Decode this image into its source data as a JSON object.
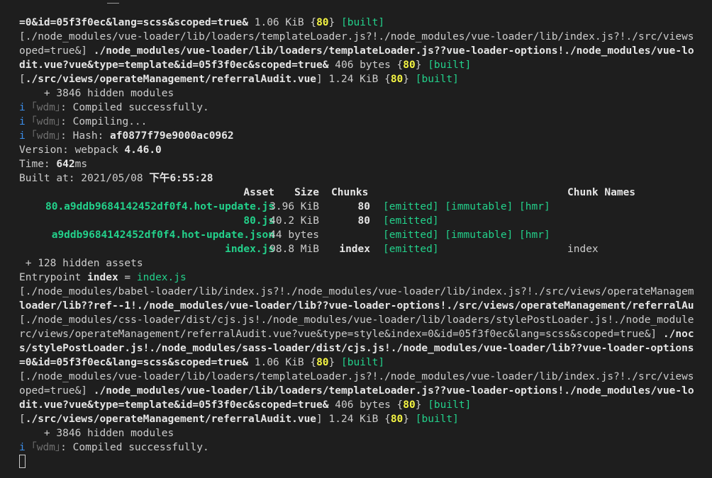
{
  "terminal": {
    "l1": {
      "p": "=0&id=05f3f0ec&lang=scss&scoped=true&",
      "size": " 1.06 KiB ",
      "chunk": "80",
      "status": "[built]"
    },
    "l2": "[./node_modules/vue-loader/lib/loaders/templateLoader.js?!./node_modules/vue-loader/lib/index.js?!./src/views",
    "l3": {
      "p1": "oped=true&] ",
      "p2": "./node_modules/vue-loader/lib/loaders/templateLoader.js??vue-loader-options!./node_modules/vue-lo"
    },
    "l4": {
      "p": "dit.vue?vue&type=template&id=05f3f0ec&scoped=true&",
      "size": " 406 bytes ",
      "chunk": "80",
      "status": "[built]"
    },
    "l5": {
      "p1": "[",
      "p2": "./src/views/operateManagement/referralAudit.vue",
      "p3": "] 1.24 KiB ",
      "chunk": "80",
      "status": "[built]"
    },
    "l6": "    + 3846 hidden modules",
    "l7": {
      "icon": "i",
      "wdm": "｢wdm｣",
      "text": ": Compiled successfully."
    },
    "l8": {
      "icon": "i",
      "wdm": "｢wdm｣",
      "text": ": Compiling..."
    },
    "l9": {
      "icon": "i",
      "wdm": "｢wdm｣",
      "text": ": Hash: ",
      "hash": "af0877f79e9000ac0962"
    },
    "l10": {
      "label": "Version: webpack ",
      "value": "4.46.0"
    },
    "l11": {
      "label": "Time: ",
      "value": "642",
      "unit": "ms"
    },
    "l12": {
      "label": "Built at: 2021/05/08 ",
      "value": "下午6:55:28"
    },
    "table": {
      "headers": {
        "asset": "Asset",
        "size": "Size",
        "chunks": "Chunks",
        "names": "Chunk Names"
      },
      "rows": [
        {
          "asset": "80.a9ddb9684142452df0f4.hot-update.js",
          "size": "3.96 KiB",
          "chunks": "80",
          "flags": "[emitted] [immutable] [hmr]",
          "name": ""
        },
        {
          "asset": "80.js",
          "size": "40.2 KiB",
          "chunks": "80",
          "flags": "[emitted]",
          "name": ""
        },
        {
          "asset": "a9ddb9684142452df0f4.hot-update.json",
          "size": "44 bytes",
          "chunks": "",
          "flags": "[emitted] [immutable] [hmr]",
          "name": ""
        },
        {
          "asset": "index.js",
          "size": "98.8 MiB",
          "chunks": "index",
          "flags": "[emitted]",
          "name": "index"
        }
      ]
    },
    "l18": " + 128 hidden assets",
    "l19": {
      "label": "Entrypoint ",
      "name": "index",
      "eq": " = ",
      "file": "index.js"
    },
    "l20": "[./node_modules/babel-loader/lib/index.js?!./node_modules/vue-loader/lib/index.js?!./src/views/operateManagem",
    "l21": "loader/lib??ref--1!./node_modules/vue-loader/lib??vue-loader-options!./src/views/operateManagement/referralAu",
    "l22": "[./node_modules/css-loader/dist/cjs.js!./node_modules/vue-loader/lib/loaders/stylePostLoader.js!./node_module",
    "l23": {
      "p1": "rc/views/operateManagement/referralAudit.vue?vue&type=style&index=0&id=05f3f0ec&lang=scss&scoped=true&] ",
      "p2": "./noc"
    },
    "l24": "s/stylePostLoader.js!./node_modules/sass-loader/dist/cjs.js!./node_modules/vue-loader/lib??vue-loader-options",
    "l25": {
      "p": "=0&id=05f3f0ec&lang=scss&scoped=true&",
      "size": " 1.06 KiB ",
      "chunk": "80",
      "status": "[built]"
    },
    "l26": "[./node_modules/vue-loader/lib/loaders/templateLoader.js?!./node_modules/vue-loader/lib/index.js?!./src/views",
    "l27": {
      "p1": "oped=true&] ",
      "p2": "./node_modules/vue-loader/lib/loaders/templateLoader.js??vue-loader-options!./node_modules/vue-lo"
    },
    "l28": {
      "p": "dit.vue?vue&type=template&id=05f3f0ec&scoped=true&",
      "size": " 406 bytes ",
      "chunk": "80",
      "status": "[built]"
    },
    "l29": {
      "p1": "[",
      "p2": "./src/views/operateManagement/referralAudit.vue",
      "p3": "] 1.24 KiB ",
      "chunk": "80",
      "status": "[built]"
    },
    "l30": "    + 3846 hidden modules",
    "l31": {
      "icon": "i",
      "wdm": "｢wdm｣",
      "text": ": Compiled successfully."
    }
  },
  "colors": {
    "background": "#1e1e1e",
    "foreground": "#cccccc",
    "green": "#23d18b",
    "yellow": "#f5f543",
    "blue": "#3b8eea",
    "dim": "#6e6e6e"
  }
}
